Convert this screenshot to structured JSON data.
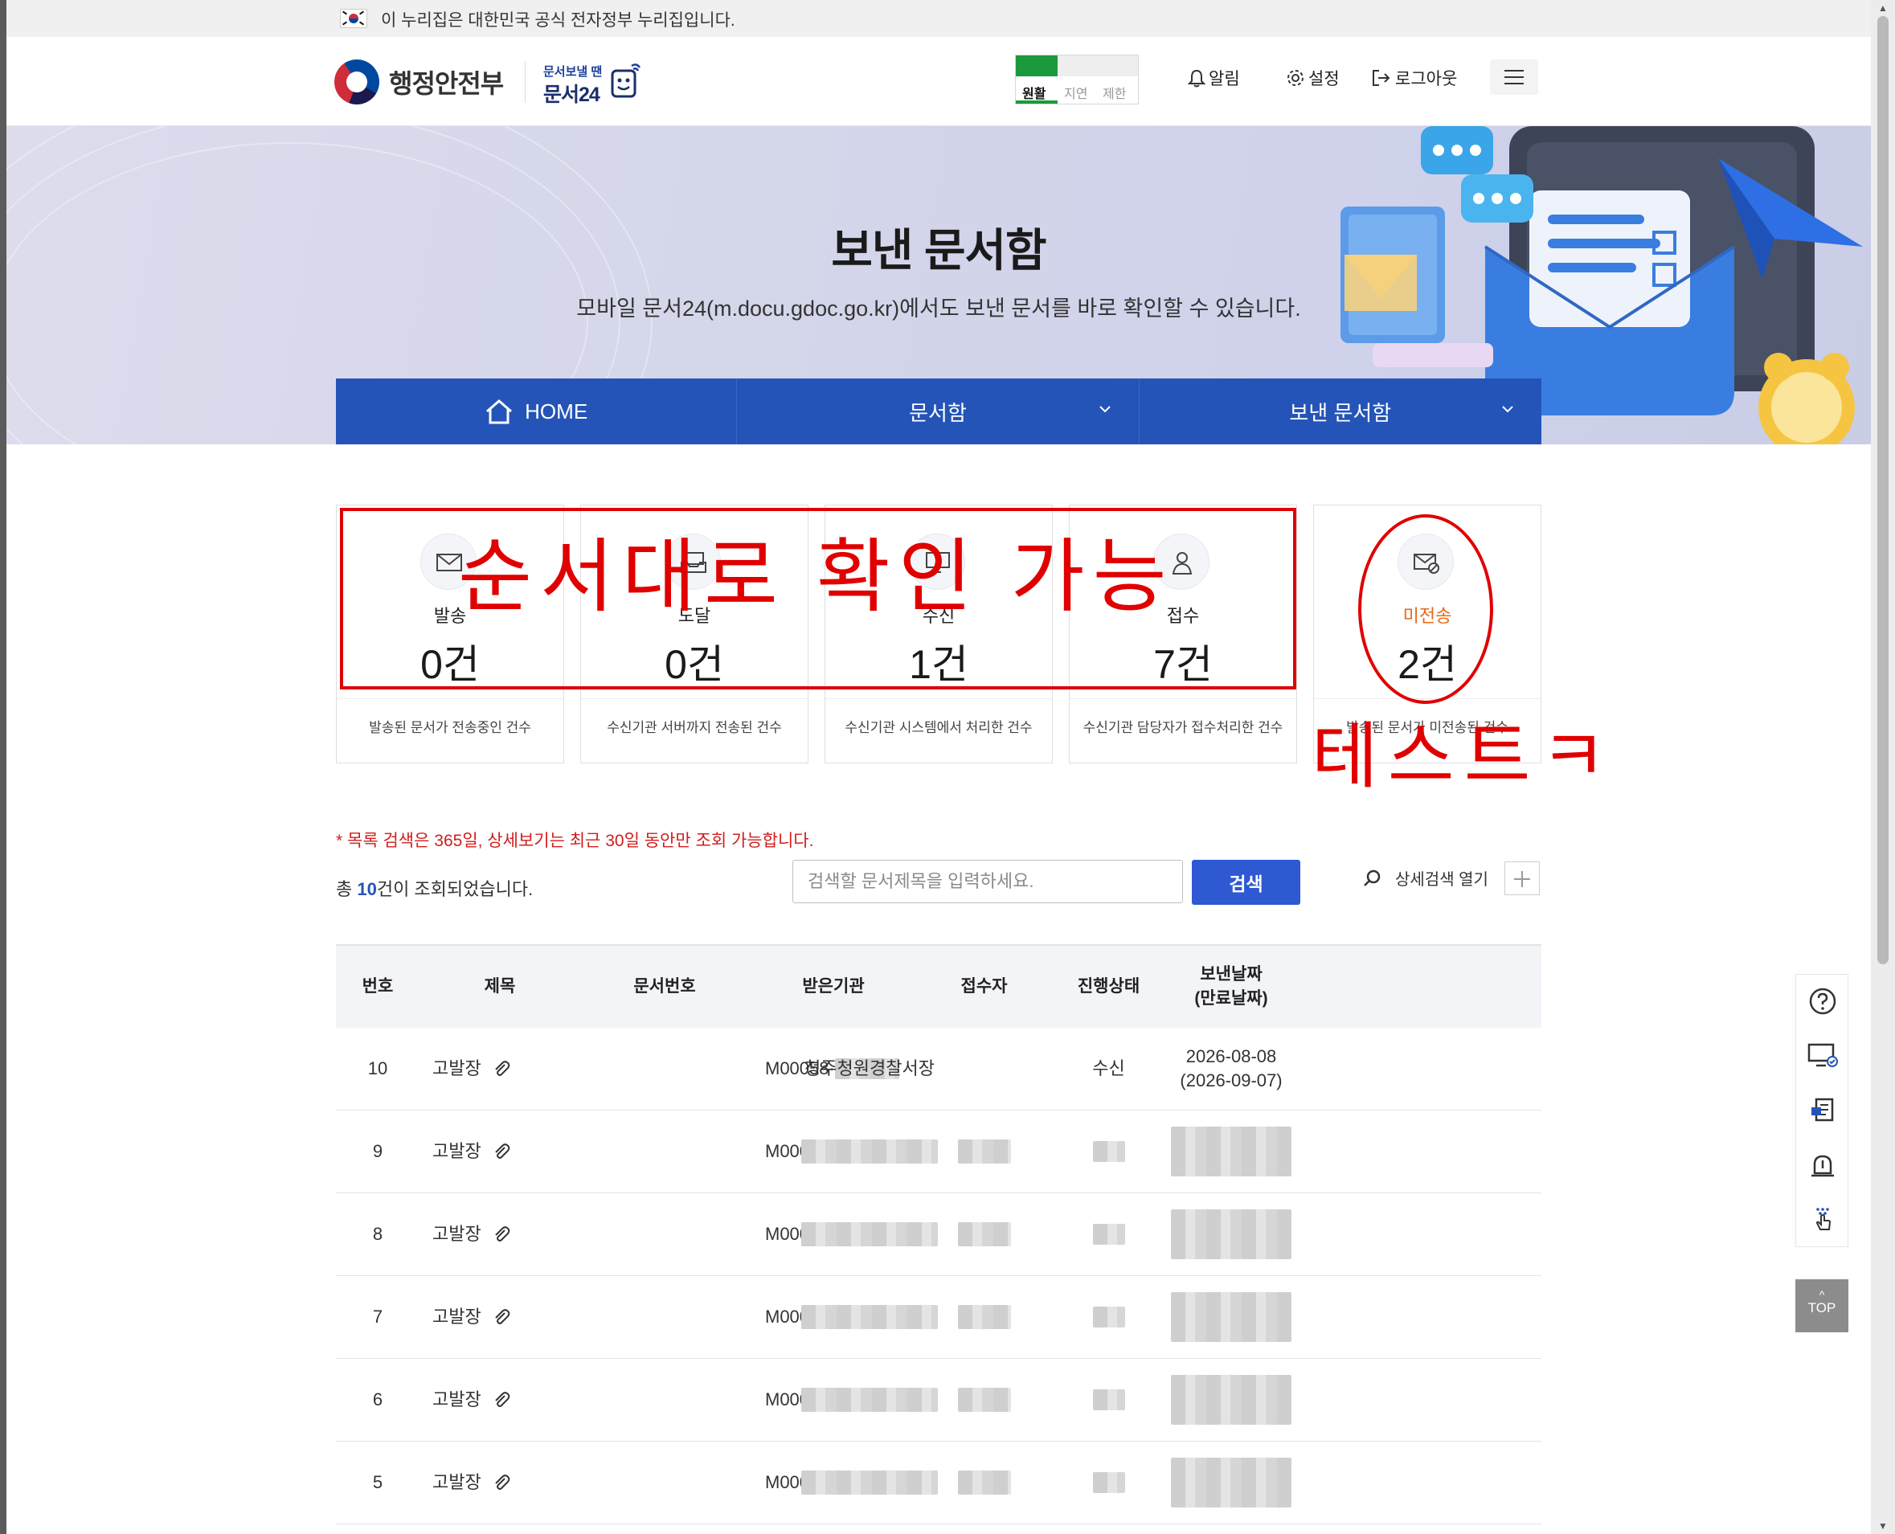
{
  "gov_banner": {
    "text": "이 누리집은 대한민국 공식 전자정부 누리집입니다."
  },
  "header": {
    "ministry": "행정안전부",
    "docu_small": "문서보낼 땐",
    "docu_big": "문서24",
    "status": [
      "원활",
      "지연",
      "제한"
    ],
    "links": {
      "alarm": "알림",
      "settings": "설정",
      "logout": "로그아웃"
    }
  },
  "hero": {
    "title": "보낸 문서함",
    "subtitle": "모바일 문서24(m.docu.gdoc.go.kr)에서도 보낸 문서를 바로 확인할 수 있습니다."
  },
  "nav": {
    "home": "HOME",
    "box": "문서함",
    "sent": "보낸 문서함"
  },
  "cards": [
    {
      "label": "발송",
      "count": "0건",
      "desc": "발송된 문서가 전송중인 건수"
    },
    {
      "label": "도달",
      "count": "0건",
      "desc": "수신기관 서버까지 전송된 건수"
    },
    {
      "label": "수신",
      "count": "1건",
      "desc": "수신기관 시스템에서 처리한 건수"
    },
    {
      "label": "접수",
      "count": "7건",
      "desc": "수신기관 담당자가 접수처리한 건수"
    },
    {
      "label": "미전송",
      "count": "2건",
      "desc": "발송된 문서가 미전송된 건수"
    }
  ],
  "annotations": {
    "a1": "순서대로 확인 가능",
    "a2": "테스트ㅋ"
  },
  "search": {
    "notice": "* 목록 검색은 365일, 상세보기는 최근 30일 동안만 조회 가능합니다.",
    "total_prefix": "총 ",
    "total_count": "10",
    "total_suffix": "건이 조회되었습니다.",
    "placeholder": "검색할 문서제목을 입력하세요.",
    "button": "검색",
    "advanced": "상세검색 열기"
  },
  "table": {
    "headers": {
      "no": "번호",
      "title": "제목",
      "docno": "문서번호",
      "org": "받은기관",
      "receiver": "접수자",
      "status": "진행상태",
      "date": "보낸날짜",
      "date2": "(만료날짜)"
    },
    "rows": [
      {
        "no": "10",
        "title": "고발장",
        "docno": "M00058·",
        "org": "청주청원경찰서장",
        "status": "수신",
        "date": "2026-08-08",
        "expire": "(2026-09-07)"
      },
      {
        "no": "9",
        "title": "고발장",
        "docno": "M00058·"
      },
      {
        "no": "8",
        "title": "고발장",
        "docno": "M00058·"
      },
      {
        "no": "7",
        "title": "고발장",
        "docno": "M00058·"
      },
      {
        "no": "6",
        "title": "고발장",
        "docno": "M00058·"
      },
      {
        "no": "5",
        "title": "고발장",
        "docno": "M00058·"
      }
    ]
  },
  "side": {
    "top": "TOP"
  }
}
